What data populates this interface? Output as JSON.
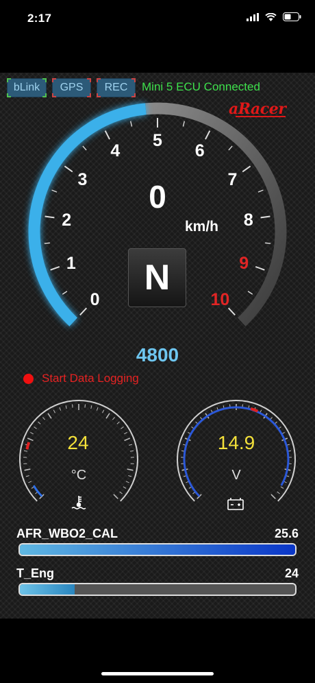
{
  "status_bar": {
    "time": "2:17"
  },
  "toolbar": {
    "blink_label": "bLink",
    "gps_label": "GPS",
    "rec_label": "REC",
    "ecu_status": "Mini 5 ECU Connected"
  },
  "brand": {
    "logo_text": "aRacer"
  },
  "speedometer": {
    "speed": "0",
    "unit": "km/h",
    "gear": "N",
    "rpm": "4800",
    "rpm_fraction": 0.48,
    "tachometer_labels": [
      "0",
      "1",
      "2",
      "3",
      "4",
      "5",
      "6",
      "7",
      "8",
      "9",
      "10"
    ],
    "redline_labels": [
      "9",
      "10"
    ],
    "colors": {
      "arc_active": "#3ab0ea",
      "arc_inactive": "#5b5b5b",
      "redline": "#e12525"
    }
  },
  "logging": {
    "label": "Start Data Logging"
  },
  "gauges": {
    "temperature": {
      "value": "24",
      "unit": "°C",
      "icon": "coolant-temperature-icon",
      "color": "#f4e13a"
    },
    "voltage": {
      "value": "14.9",
      "unit": "V",
      "icon": "battery-icon",
      "color": "#f4e13a"
    }
  },
  "bars": [
    {
      "label": "AFR_WBO2_CAL",
      "value": "25.6",
      "fraction": 1.0
    },
    {
      "label": "T_Eng",
      "value": "24",
      "fraction": 0.2
    }
  ]
}
